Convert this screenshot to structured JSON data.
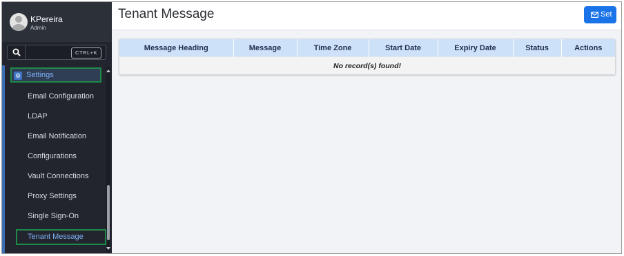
{
  "user": {
    "name": "KPereira",
    "role": "Admin"
  },
  "search": {
    "shortcut": "CTRL+K"
  },
  "sidebar": {
    "parent_label": "Settings",
    "items": [
      {
        "label": "Email Configuration"
      },
      {
        "label": "LDAP"
      },
      {
        "label": "Email Notification"
      },
      {
        "label": "Configurations"
      },
      {
        "label": "Vault Connections"
      },
      {
        "label": "Proxy Settings"
      },
      {
        "label": "Single Sign-On"
      },
      {
        "label": "Tenant Message"
      }
    ],
    "active_item": "Tenant Message"
  },
  "header": {
    "title": "Tenant Message",
    "set_label": "Set"
  },
  "table": {
    "columns": [
      "Message Heading",
      "Message",
      "Time Zone",
      "Start Date",
      "Expiry Date",
      "Status",
      "Actions"
    ],
    "empty_text": "No record(s) found!"
  },
  "colors": {
    "accent": "#1a73e8",
    "sidebar_bg": "#22252e",
    "highlight_border": "#1e8a4a",
    "table_header": "#cde2f9"
  }
}
